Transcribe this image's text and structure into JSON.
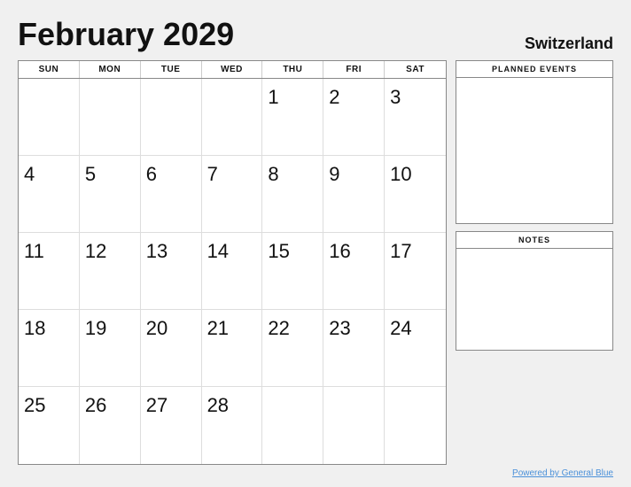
{
  "header": {
    "title": "February 2029",
    "country": "Switzerland"
  },
  "day_headers": [
    "SUN",
    "MON",
    "TUE",
    "WED",
    "THU",
    "FRI",
    "SAT"
  ],
  "weeks": [
    [
      null,
      null,
      null,
      null,
      1,
      2,
      3
    ],
    [
      4,
      5,
      6,
      7,
      8,
      9,
      10
    ],
    [
      11,
      12,
      13,
      14,
      15,
      16,
      17
    ],
    [
      18,
      19,
      20,
      21,
      22,
      23,
      24
    ],
    [
      25,
      26,
      27,
      28,
      null,
      null,
      null
    ]
  ],
  "panels": {
    "events_label": "PLANNED EVENTS",
    "notes_label": "NOTES"
  },
  "footer": {
    "text": "Powered by General Blue"
  }
}
